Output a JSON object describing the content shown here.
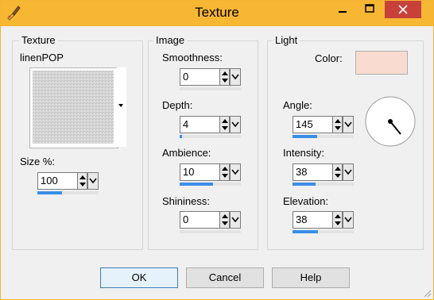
{
  "window": {
    "title": "Texture"
  },
  "texture": {
    "group_label": "Texture",
    "name": "linenPOP",
    "size_label": "Size %:",
    "size": {
      "value": "100",
      "level": 0.4
    }
  },
  "image": {
    "group_label": "Image",
    "smoothness": {
      "label": "Smoothness:",
      "value": "0",
      "level": 0
    },
    "depth": {
      "label": "Depth:",
      "value": "4",
      "level": 0.04
    },
    "ambience": {
      "label": "Ambience:",
      "value": "10",
      "level": 0.55
    },
    "shininess": {
      "label": "Shininess:",
      "value": "0",
      "level": 0
    }
  },
  "light": {
    "group_label": "Light",
    "color_label": "Color:",
    "color": "#f9dccf",
    "angle": {
      "label": "Angle:",
      "value": "145",
      "level": 0.4
    },
    "intensity": {
      "label": "Intensity:",
      "value": "38",
      "level": 0.38
    },
    "elevation": {
      "label": "Elevation:",
      "value": "38",
      "level": 0.42
    }
  },
  "buttons": {
    "ok": "OK",
    "cancel": "Cancel",
    "help": "Help"
  },
  "colors": {
    "titlebar": "#f7b733",
    "close": "#c7413a",
    "slider_fill": "#3a8ee6"
  }
}
